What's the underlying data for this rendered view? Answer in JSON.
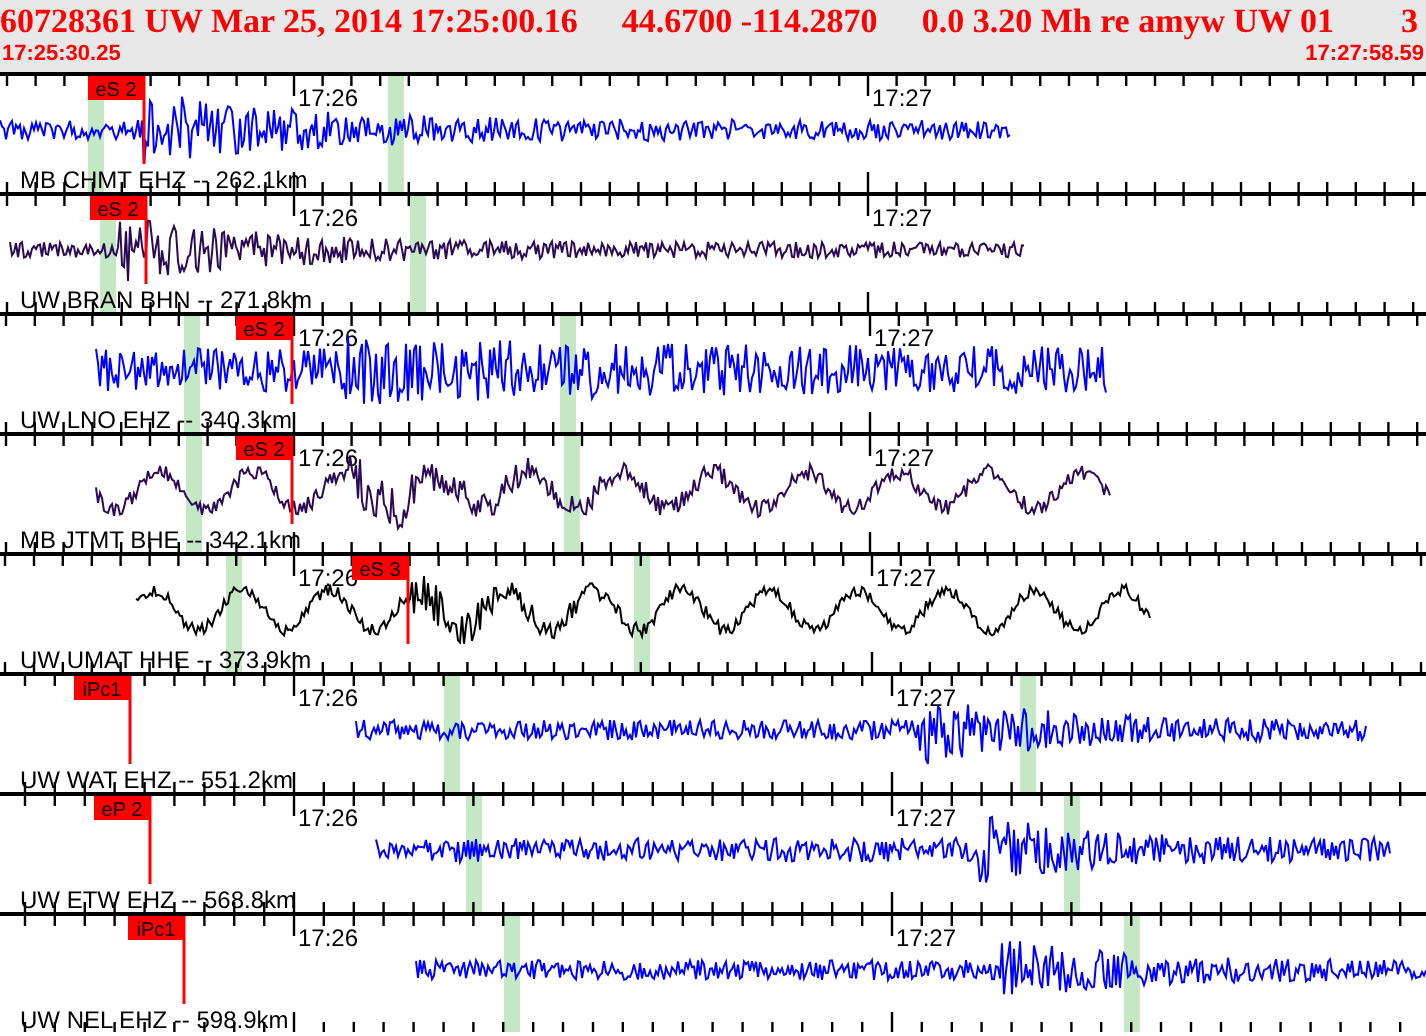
{
  "header": {
    "event_parts": [
      "60728361 UW Mar 25, 2014 17:25:00.16",
      "44.6700 -114.2870",
      "0.0 3.20 Mh re amyw UW 01",
      "3"
    ],
    "start_time": "17:25:30.25",
    "end_time": "17:27:58.59"
  },
  "traces": [
    {
      "station": "MB CHMT EHZ -- 262.1km",
      "color": "#0000ff",
      "pick": "eS 2",
      "time_labels": [
        "17:26",
        "17:27"
      ]
    },
    {
      "station": "UW BRAN BHN -- 271.8km",
      "color": "#2a0a55",
      "pick": "eS 2",
      "time_labels": [
        "17:26",
        "17:27"
      ]
    },
    {
      "station": "UW LNO EHZ -- 340.3km",
      "color": "#0000ff",
      "pick": "eS 2",
      "time_labels": [
        "17:26",
        "17:27"
      ]
    },
    {
      "station": "MB JTMT BHE -- 342.1km",
      "color": "#2a0a55",
      "pick": "eS 2",
      "time_labels": [
        "17:26",
        "17:27"
      ]
    },
    {
      "station": "UW UMAT HHE -- 373.9km",
      "color": "#000000",
      "pick": "eS 3",
      "time_labels": [
        "17:26",
        "17:27"
      ]
    },
    {
      "station": "UW WAT EHZ -- 551.2km",
      "color": "#0000ff",
      "pick": "iPc1",
      "time_labels": [
        "17:26",
        "17:27"
      ]
    },
    {
      "station": "UW ETW EHZ -- 568.8km",
      "color": "#0000ff",
      "pick": "eP 2",
      "time_labels": [
        "17:26",
        "17:27"
      ]
    },
    {
      "station": "UW NEL EHZ -- 598.9km",
      "color": "#0000ff",
      "pick": "iPc1",
      "time_labels": [
        "17:26",
        "17:27"
      ]
    }
  ]
}
